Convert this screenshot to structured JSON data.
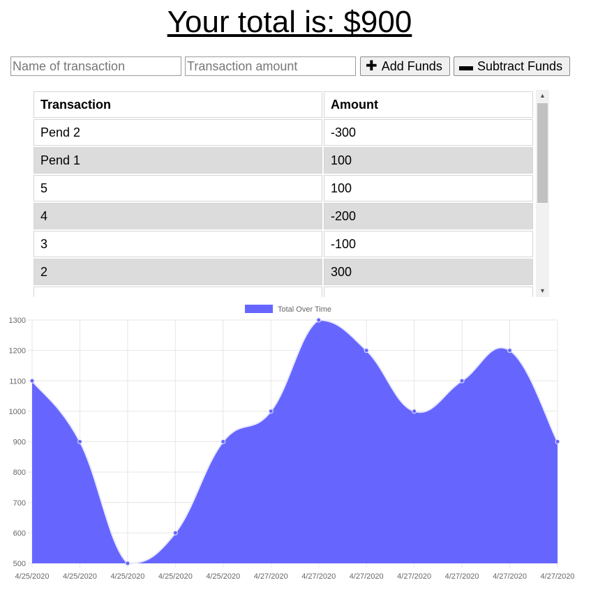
{
  "header": {
    "title": "Your total is: $900"
  },
  "form": {
    "name_placeholder": "Name of transaction",
    "amount_placeholder": "Transaction amount",
    "add_label": "Add Funds",
    "subtract_label": "Subtract Funds"
  },
  "table": {
    "columns": [
      "Transaction",
      "Amount"
    ],
    "rows": [
      {
        "name": "Pend 2",
        "amount": "-300"
      },
      {
        "name": "Pend 1",
        "amount": "100"
      },
      {
        "name": "5",
        "amount": "100"
      },
      {
        "name": "4",
        "amount": "-200"
      },
      {
        "name": "3",
        "amount": "-100"
      },
      {
        "name": "2",
        "amount": "300"
      }
    ]
  },
  "colors": {
    "series_fill": "#6666ff",
    "series_line": "#e8e8ff",
    "grid": "#e6e6e6"
  },
  "chart_data": {
    "type": "area",
    "title": "",
    "legend": {
      "placement": "top-center"
    },
    "grid": true,
    "x": [
      "4/25/2020",
      "4/25/2020",
      "4/25/2020",
      "4/25/2020",
      "4/25/2020",
      "4/27/2020",
      "4/27/2020",
      "4/27/2020",
      "4/27/2020",
      "4/27/2020",
      "4/27/2020",
      "4/27/2020"
    ],
    "series": [
      {
        "name": "Total Over Time",
        "values": [
          1100,
          900,
          500,
          600,
          900,
          1000,
          1300,
          1200,
          1000,
          1100,
          1200,
          900
        ]
      }
    ],
    "ylim": [
      500,
      1300
    ],
    "yticks": [
      500,
      600,
      700,
      800,
      900,
      1000,
      1100,
      1200,
      1300
    ]
  }
}
